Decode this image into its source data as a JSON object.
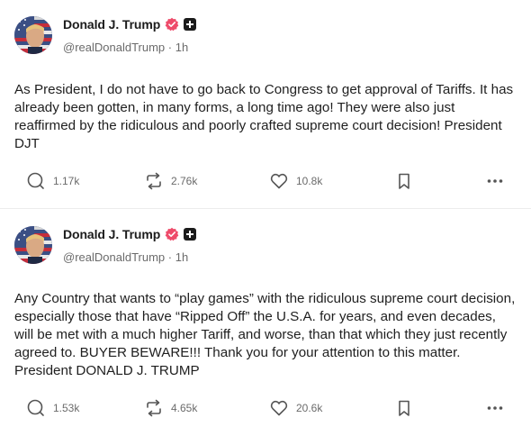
{
  "posts": [
    {
      "author": {
        "display_name": "Donald J. Trump",
        "handle": "@realDonaldTrump",
        "separator": "·",
        "time": "1h"
      },
      "text": "As President, I do not have to go back to Congress to get approval of Tariffs. It has already been gotten, in many forms, a long time ago! They were also just reaffirmed by the ridiculous and poorly crafted supreme court decision! President DJT",
      "counts": {
        "replies": "1.17k",
        "retruths": "2.76k",
        "likes": "10.8k"
      },
      "icons": {
        "reply": "reply-icon",
        "retruth": "retruth-icon",
        "like": "heart-icon",
        "bookmark": "bookmark-icon",
        "more": "more-icon"
      }
    },
    {
      "author": {
        "display_name": "Donald J. Trump",
        "handle": "@realDonaldTrump",
        "separator": "·",
        "time": "1h"
      },
      "text": "Any Country that wants to “play games” with the ridiculous supreme court decision, especially those that have “Ripped Off” the U.S.A. for years, and even decades, will be met with a much higher Tariff, and worse, than that which they just recently agreed to. BUYER BEWARE!!! Thank you for your attention to this matter. President DONALD J. TRUMP",
      "counts": {
        "replies": "1.53k",
        "retruths": "4.65k",
        "likes": "20.6k"
      },
      "icons": {
        "reply": "reply-icon",
        "retruth": "retruth-icon",
        "like": "heart-icon",
        "bookmark": "bookmark-icon",
        "more": "more-icon"
      }
    }
  ],
  "colors": {
    "verified": "#ee4b6a",
    "text": "#1f1f1f",
    "muted": "#6b6b6b",
    "divider": "#ececec"
  }
}
